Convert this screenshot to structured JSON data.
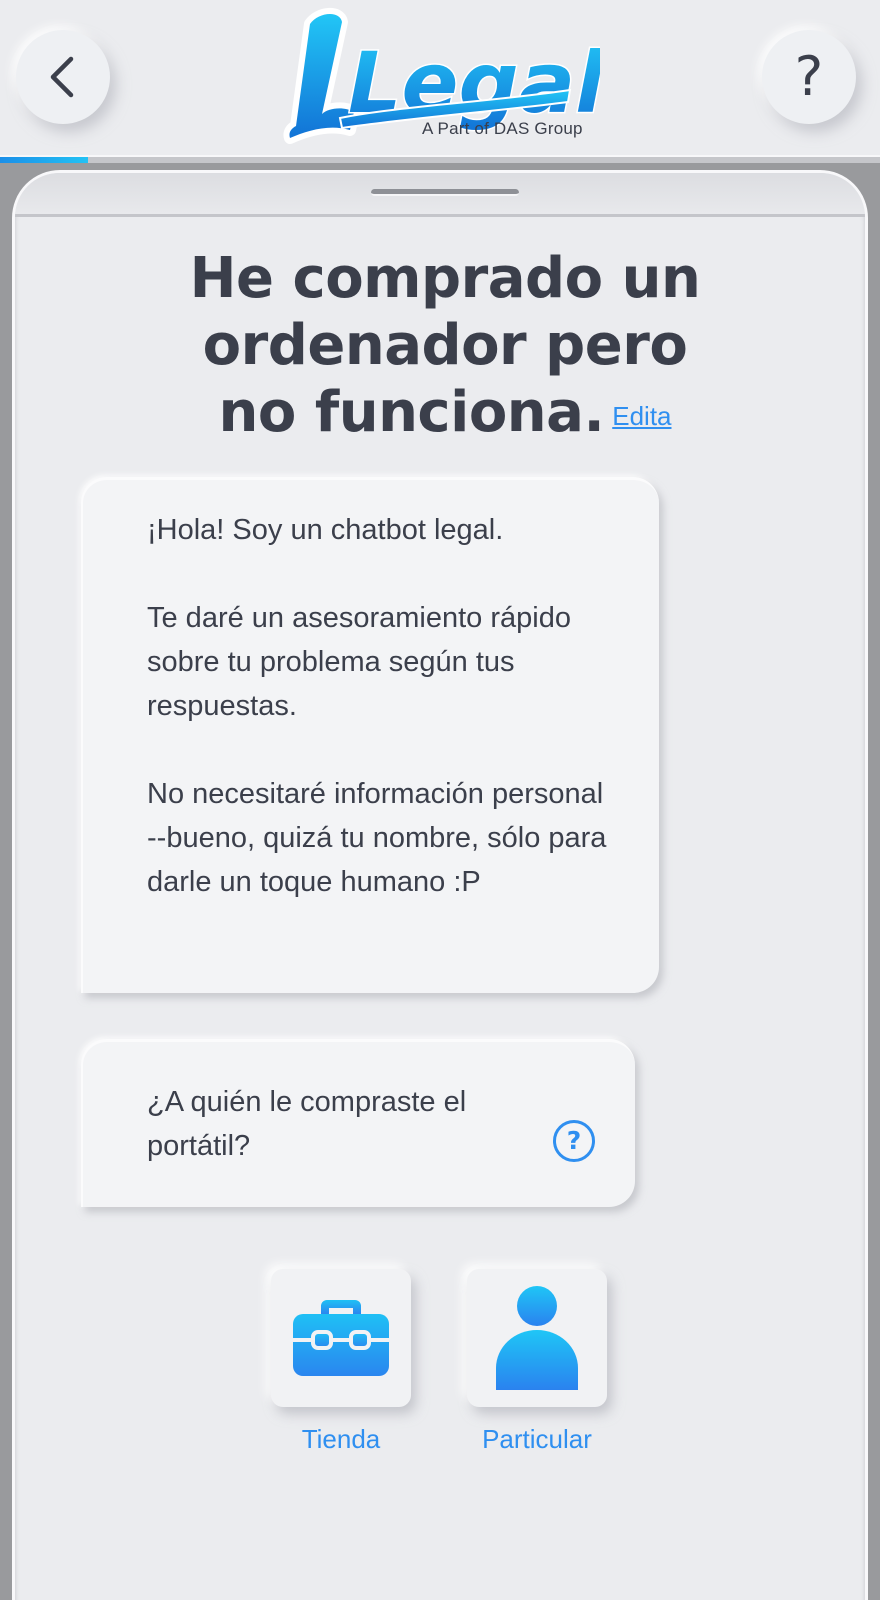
{
  "header": {
    "logo_text": "Legally",
    "logo_subtitle": "A Part of DAS Group",
    "back_icon": "chevron-left-icon",
    "help_label": "?",
    "progress": 0.1
  },
  "main": {
    "title_lines": [
      "He comprado un",
      "ordenador pero",
      "no funciona."
    ],
    "edit_link": "Edita",
    "intro_message": [
      "¡Hola! Soy un chatbot legal.",
      "Te daré un asesoramiento rápido sobre tu problema según tus respuestas.",
      "No necesitaré información personal --bueno, quizá tu nombre, sólo para darle un toque humano :P"
    ],
    "question": {
      "text": "¿A quién le compraste el portátil?",
      "help_icon": "question-circle-icon",
      "help_label": "?"
    },
    "options": [
      {
        "label": "Tienda",
        "icon": "briefcase-icon"
      },
      {
        "label": "Particular",
        "icon": "person-icon"
      }
    ]
  },
  "colors": {
    "accent": "#2f8ff0",
    "text": "#3b3f4b",
    "background": "#ebecef",
    "logo_gradient_start": "#1fb8f3",
    "logo_gradient_end": "#1274d8"
  }
}
